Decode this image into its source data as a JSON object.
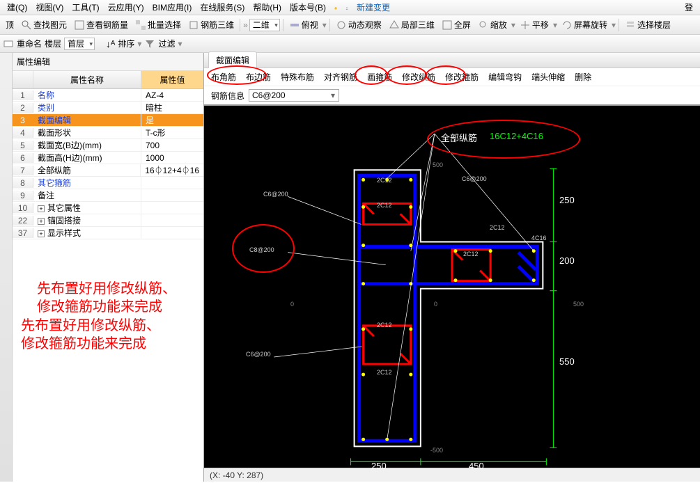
{
  "menu": {
    "items": [
      "建(Q)",
      "视图(V)",
      "工具(T)",
      "云应用(Y)",
      "BIM应用(I)",
      "在线服务(S)",
      "帮助(H)",
      "版本号(B)"
    ],
    "new_change": "新建变更",
    "login": "登"
  },
  "tb1": {
    "items": [
      "顶",
      "查找图元",
      "查看钢筋量",
      "批量选择",
      "钢筋三维"
    ],
    "view_dd": "二维",
    "items2": [
      "俯视",
      "动态观察",
      "局部三维",
      "全屏",
      "缩放",
      "平移",
      "屏幕旋转",
      "选择楼层"
    ]
  },
  "tb2": {
    "rename": "重命名",
    "floor": "楼层",
    "first": "首层",
    "sort": "排序",
    "filter": "过滤"
  },
  "panel": {
    "title": "属性编辑",
    "h_name": "属性名称",
    "h_val": "属性值",
    "rows": [
      {
        "n": "1",
        "name": "名称",
        "val": "AZ-4",
        "cls": "blue-text"
      },
      {
        "n": "2",
        "name": "类别",
        "val": "暗柱",
        "cls": "blue-text"
      },
      {
        "n": "3",
        "name": "截面编辑",
        "val": "是",
        "hl": true,
        "cls": "blue-text"
      },
      {
        "n": "4",
        "name": "截面形状",
        "val": "T-c形"
      },
      {
        "n": "5",
        "name": "截面宽(B边)(mm)",
        "val": "700"
      },
      {
        "n": "6",
        "name": "截面高(H边)(mm)",
        "val": "1000"
      },
      {
        "n": "7",
        "name": "全部纵筋",
        "val": "16⏀12+4⏀16"
      },
      {
        "n": "8",
        "name": "其它箍筋",
        "val": "",
        "cls": "blue-text"
      },
      {
        "n": "9",
        "name": "备注",
        "val": ""
      },
      {
        "n": "10",
        "name": "其它属性",
        "val": "",
        "exp": true
      },
      {
        "n": "22",
        "name": "锚固搭接",
        "val": "",
        "exp": true
      },
      {
        "n": "37",
        "name": "显示样式",
        "val": "",
        "exp": true
      }
    ]
  },
  "editor": {
    "tab": "截面编辑",
    "ops": [
      "布角筋",
      "布边筋",
      "特殊布筋",
      "对齐钢筋",
      "画箍筋",
      "修改纵筋",
      "修改箍筋",
      "编辑弯钩",
      "端头伸缩",
      "删除"
    ],
    "steel_label": "钢筋信息",
    "steel_value": "C6@200"
  },
  "annot": {
    "all_rebar": "全部纵筋",
    "all_rebar_val": "16C12+4C16",
    "note": "先布置好用修改纵筋、\n修改箍筋功能来完成",
    "d250": "250",
    "d200": "200",
    "d550": "550",
    "d450": "450",
    "d250b": "250",
    "c6200": "C6@200",
    "c8200": "C8@200",
    "r2c12": "2C12",
    "r4c16": "4C16"
  },
  "status": {
    "coords": "(X: -40 Y: 287)"
  }
}
